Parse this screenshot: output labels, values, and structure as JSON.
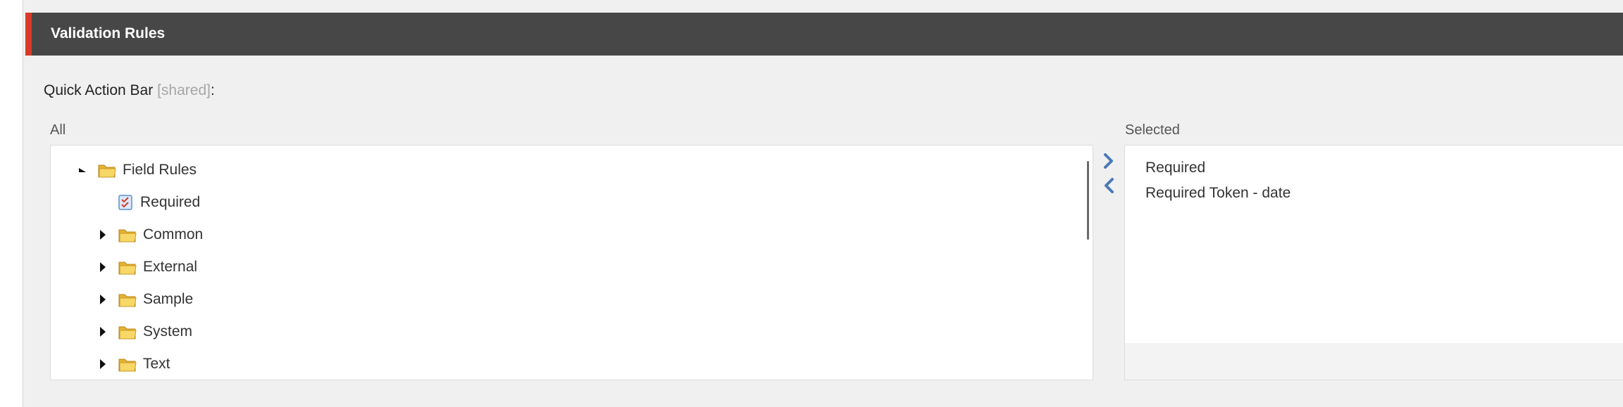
{
  "section": {
    "title": "Validation Rules"
  },
  "field": {
    "label": "Quick Action Bar",
    "shared": "[shared]",
    "colon": ":"
  },
  "lists": {
    "all_caption": "All",
    "selected_caption": "Selected"
  },
  "tree": {
    "root": {
      "label": "Field Rules",
      "expanded": true
    },
    "children": [
      {
        "label": "Required",
        "kind": "rule"
      },
      {
        "label": "Common",
        "kind": "folder"
      },
      {
        "label": "External",
        "kind": "folder"
      },
      {
        "label": "Sample",
        "kind": "folder"
      },
      {
        "label": "System",
        "kind": "folder"
      },
      {
        "label": "Text",
        "kind": "folder"
      }
    ]
  },
  "selected": {
    "items": [
      "Required",
      "Required Token - date"
    ]
  },
  "colors": {
    "accent": "#d93a2b",
    "header_bg": "#474747",
    "arrow": "#4a7ab5",
    "folder": "#f2c744"
  }
}
